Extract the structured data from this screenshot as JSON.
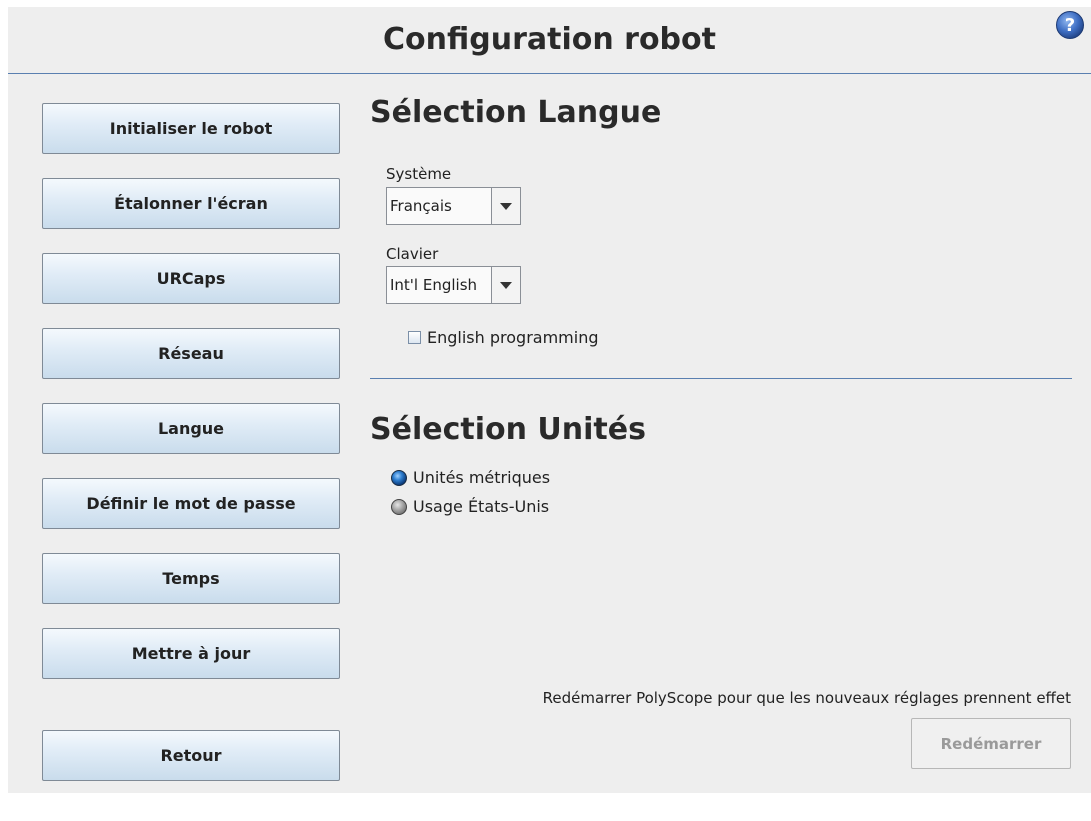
{
  "header": {
    "title": "Configuration robot",
    "help_icon": "help-circle-icon"
  },
  "sidebar": {
    "items": [
      {
        "label": "Initialiser le robot"
      },
      {
        "label": "Étalonner l'écran"
      },
      {
        "label": "URCaps"
      },
      {
        "label": "Réseau"
      },
      {
        "label": "Langue"
      },
      {
        "label": "Définir le mot de passe"
      },
      {
        "label": "Temps"
      },
      {
        "label": "Mettre à jour"
      }
    ],
    "back_label": "Retour"
  },
  "language": {
    "heading": "Sélection Langue",
    "system_label": "Système",
    "system_value": "Français",
    "keyboard_label": "Clavier",
    "keyboard_value": "Int'l English",
    "english_programming_label": "English programming",
    "english_programming_checked": false
  },
  "units": {
    "heading": "Sélection Unités",
    "options": [
      {
        "label": "Unités métriques",
        "selected": true
      },
      {
        "label": "Usage États-Unis",
        "selected": false
      }
    ]
  },
  "footer": {
    "restart_note": "Redémarrer PolyScope pour que les nouveaux réglages prennent effet",
    "restart_label": "Redémarrer",
    "restart_enabled": false
  },
  "colors": {
    "accent_line": "#5a7fb0",
    "background": "#eeeeee",
    "radio_selected": "#2f7fd0"
  }
}
